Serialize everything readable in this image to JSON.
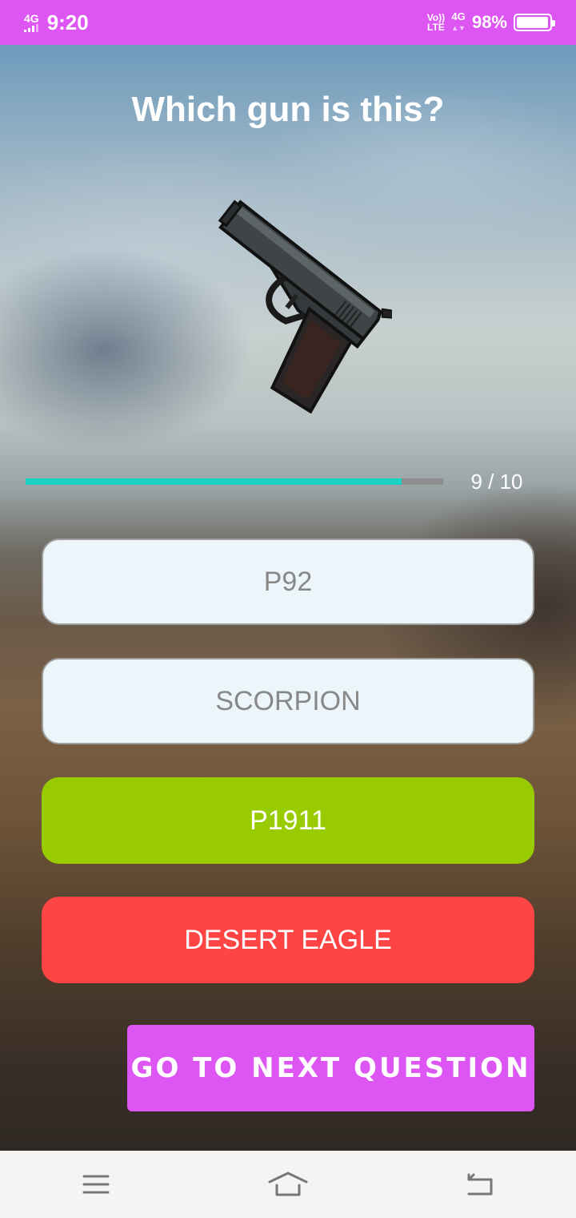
{
  "status_bar": {
    "network_left": "4G",
    "time": "9:20",
    "volte": "Vo))\nLTE",
    "network_right": "4G",
    "battery_percent": "98%",
    "battery_level": 0.98
  },
  "quiz": {
    "question": "Which gun is this?",
    "image_icon": "pistol-icon",
    "progress": {
      "current": 9,
      "total": 10,
      "label": "9 / 10",
      "fraction": 0.9
    },
    "options": [
      {
        "label": "P92",
        "state": "neutral"
      },
      {
        "label": "SCORPION",
        "state": "neutral"
      },
      {
        "label": "P1911",
        "state": "correct"
      },
      {
        "label": "DESERT EAGLE",
        "state": "wrong"
      }
    ],
    "next_button_label": "GO TO NEXT QUESTION"
  },
  "nav_bar": {
    "menu_icon": "menu-icon",
    "home_icon": "home-icon",
    "back_icon": "back-icon"
  },
  "colors": {
    "accent": "#dd55f2",
    "progress": "#19d1c4",
    "correct": "#99cc00",
    "wrong": "#ff4444",
    "neutral_bg": "#ecf5f9"
  }
}
